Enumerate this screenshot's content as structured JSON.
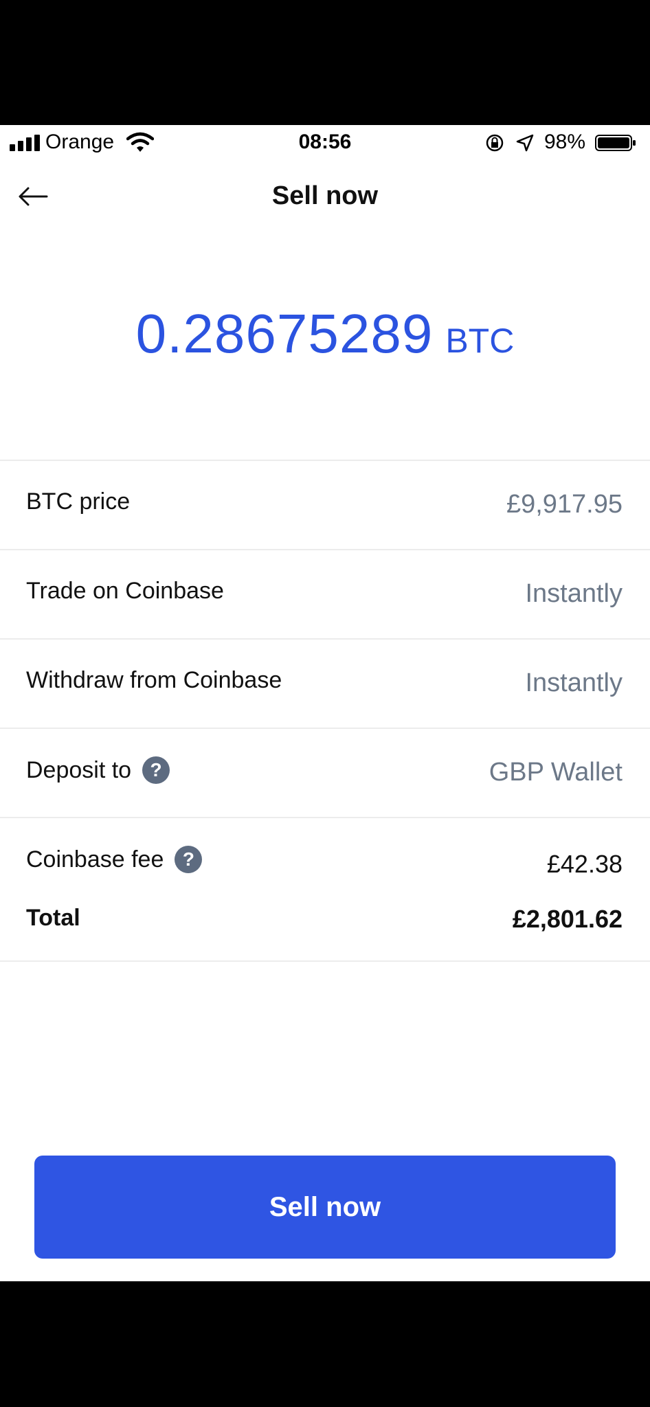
{
  "status_bar": {
    "carrier": "Orange",
    "time": "08:56",
    "battery_percent": "98%"
  },
  "nav": {
    "title": "Sell now"
  },
  "amount": {
    "value": "0.28675289",
    "unit": "BTC"
  },
  "rows": [
    {
      "label": "BTC price",
      "value": "£9,917.95"
    },
    {
      "label": "Trade on Coinbase",
      "value": "Instantly"
    },
    {
      "label": "Withdraw from Coinbase",
      "value": "Instantly"
    },
    {
      "label": "Deposit to",
      "value": "GBP Wallet"
    }
  ],
  "fee": {
    "label": "Coinbase fee",
    "value": "£42.38",
    "total_label": "Total",
    "total_value": "£2,801.62"
  },
  "help_glyph": "?",
  "button": {
    "label": "Sell now"
  },
  "colors": {
    "accent": "#2f55e3",
    "amount_text": "#2b53e0",
    "muted_value": "#6c7888",
    "help_icon_bg": "#5d6b80"
  },
  "icons": [
    "back-arrow-icon",
    "help-icon",
    "wifi-icon",
    "signal-icon",
    "orientation-lock-icon",
    "location-icon",
    "battery-icon"
  ]
}
